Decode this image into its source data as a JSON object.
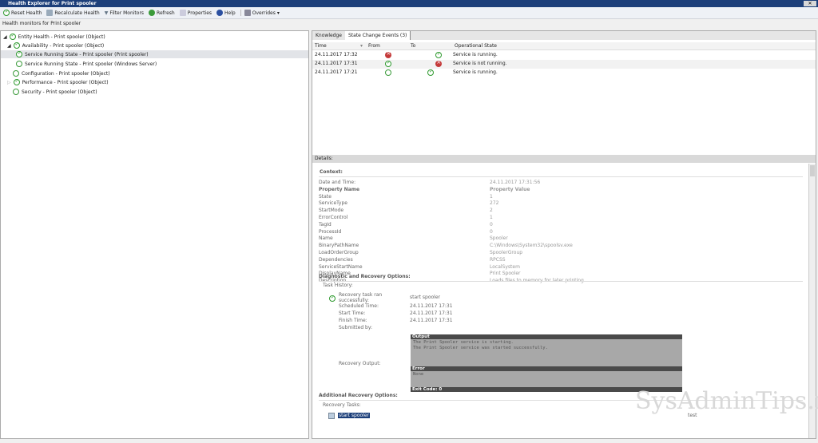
{
  "window": {
    "title": "Health Explorer for Print spooler",
    "close": "✕"
  },
  "toolbar": {
    "reset": "Reset Health",
    "recalc": "Recalculate Health",
    "filter": "Filter Monitors",
    "refresh": "Refresh",
    "properties": "Properties",
    "help": "Help",
    "overrides": "Overrides"
  },
  "subtitle": "Health monitors for Print spooler",
  "tree": [
    {
      "label": "Entity Health - Print spooler (Object)",
      "state": "ok"
    },
    {
      "label": "Availability - Print spooler (Object)",
      "state": "ok"
    },
    {
      "label": "Service Running State - Print spooler (Print spooler)",
      "state": "ok"
    },
    {
      "label": "Service Running State - Print spooler (Windows Server)",
      "state": "empty"
    },
    {
      "label": "Configuration - Print spooler (Object)",
      "state": "empty"
    },
    {
      "label": "Performance - Print spooler (Object)",
      "state": "ok"
    },
    {
      "label": "Security - Print spooler (Object)",
      "state": "empty"
    }
  ],
  "tabs": [
    "Knowledge",
    "State Change Events (3)"
  ],
  "events": {
    "headers": [
      "Time",
      "From",
      "To",
      "Operational State"
    ],
    "rows": [
      {
        "time": "24.11.2017 17:32",
        "from": "err",
        "to": "ok",
        "state": "Service is running."
      },
      {
        "time": "24.11.2017 17:31",
        "from": "ok",
        "to": "err",
        "state": "Service is not running."
      },
      {
        "time": "24.11.2017 17:21",
        "from": "empty",
        "to": "ok",
        "state": "Service is running."
      }
    ]
  },
  "details": {
    "label": "Details:",
    "context": "Context:",
    "props": [
      [
        "Date and Time:",
        "24.11.2017 17:31:56"
      ],
      [
        "Property Name",
        "Property Value"
      ],
      [
        "State",
        "1"
      ],
      [
        "ServiceType",
        "272"
      ],
      [
        "StartMode",
        "2"
      ],
      [
        "ErrorControl",
        "1"
      ],
      [
        "TagId",
        "0"
      ],
      [
        "ProcessId",
        "0"
      ],
      [
        "Name",
        "Spooler"
      ],
      [
        "BinaryPathName",
        "C:\\Windows\\System32\\spoolsv.exe"
      ],
      [
        "LoadOrderGroup",
        "SpoolerGroup"
      ],
      [
        "Dependencies",
        "RPCSS"
      ],
      [
        "ServiceStartName",
        "LocalSystem"
      ],
      [
        "DisplayName",
        "Print Spooler"
      ],
      [
        "Description",
        "Loads files to memory for later printing"
      ]
    ],
    "diag": "Diagnostic and Recovery Options:",
    "history": "Task History:",
    "task_ok": "Recovery task ran successfully:",
    "task_name": "start spooler",
    "times": [
      [
        "Scheduled Time:",
        "24.11.2017 17:31"
      ],
      [
        "Start Time:",
        "24.11.2017 17:31"
      ],
      [
        "Finish Time:",
        "24.11.2017 17:31"
      ],
      [
        "Submitted by:",
        ""
      ]
    ],
    "recovery_output": "Recovery Output:",
    "output_h": "Output",
    "output_1": "The Print Spooler service is starting.",
    "output_2": "The Print Spooler service was started successfully.",
    "error_h": "Error",
    "error_v": "None",
    "exit": "Exit Code: 0",
    "additional": "Additional Recovery Options:",
    "tasks": "Recovery Tasks:",
    "task_link": "start spooler",
    "task_test": "test"
  },
  "watermark": "SysAdminTips.ru"
}
